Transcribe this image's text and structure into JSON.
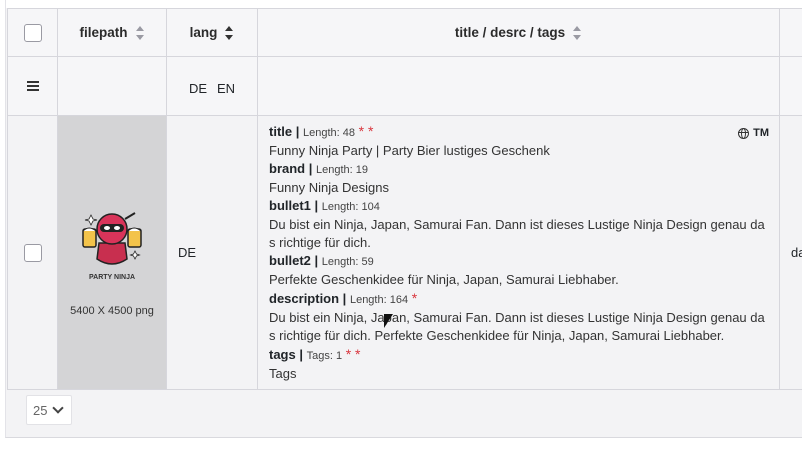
{
  "header": {
    "filepath": "filepath",
    "lang": "lang",
    "title": "title / desrc / tags"
  },
  "filter": {
    "lang_de": "DE",
    "lang_en": "EN"
  },
  "row": {
    "image_label": "PARTY NINJA",
    "dimensions": "5400 X 4500 png",
    "lang": "DE",
    "extra": "da",
    "badge": "TM",
    "title_label": "title |",
    "title_len": "Length: 48",
    "title_req": "* *",
    "title_value": "Funny Ninja Party | Party Bier lustiges Geschenk",
    "brand_label": "brand |",
    "brand_len": "Length: 19",
    "brand_value": "Funny Ninja Designs",
    "bullet1_label": "bullet1 |",
    "bullet1_len": "Length: 104",
    "bullet1_value_1": "Du bist ein Ninja, Japan, Samurai Fan. Dann ist dieses Lustige Ninja Design genau da",
    "bullet1_value_2": "s richtige für dich.",
    "bullet2_label": "bullet2 |",
    "bullet2_len": "Length: 59",
    "bullet2_value": "Perfekte Geschenkidee für Ninja, Japan, Samurai Liebhaber.",
    "desc_label": "description |",
    "desc_len": "Length: 164",
    "desc_req": "*",
    "desc_value_1": "Du bist ein Ninja, Japan, Samurai Fan. Dann ist dieses Lustige Ninja Design genau da",
    "desc_value_2": "s richtige für dich. Perfekte Geschenkidee für Ninja, Japan, Samurai Liebhaber.",
    "tags_label": "tags |",
    "tags_len": "Tags: 1",
    "tags_req": "* *",
    "tags_value": "Tags"
  },
  "pager": {
    "page_size": "25"
  },
  "icons": {
    "sort": "sort-icon",
    "list": "list-icon",
    "globe": "globe-icon",
    "chevron": "chevron-down-icon"
  }
}
